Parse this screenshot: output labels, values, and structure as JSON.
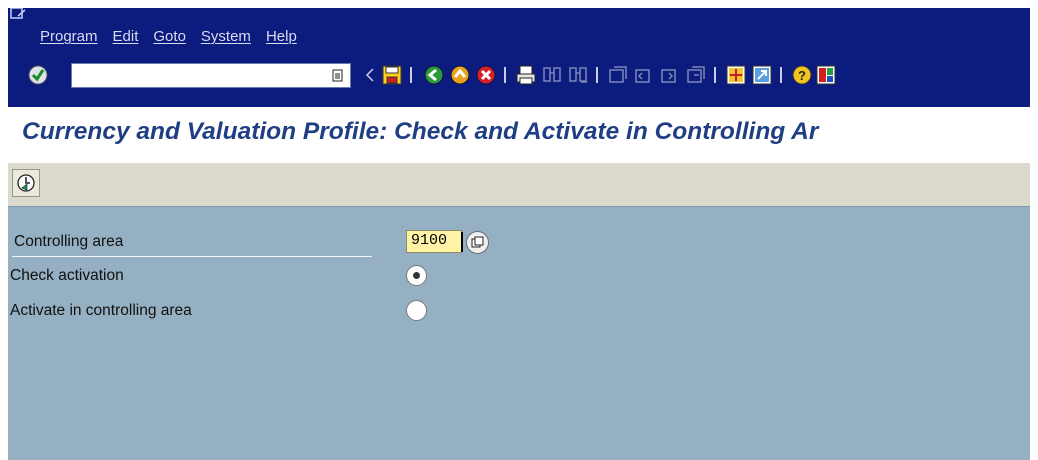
{
  "menu": {
    "items": [
      "Program",
      "Edit",
      "Goto",
      "System",
      "Help"
    ]
  },
  "toolbar": {
    "command_field_value": "",
    "icons": [
      "enter-icon",
      "command-dropdown-icon",
      "prev-arrow-icon",
      "save-icon",
      "back-icon",
      "exit-icon",
      "cancel-icon",
      "print-icon",
      "find-icon",
      "find-next-icon",
      "first-page-icon",
      "previous-page-icon",
      "next-page-icon",
      "last-page-icon",
      "create-session-icon",
      "shortcut-icon",
      "help-icon",
      "customize-layout-icon"
    ]
  },
  "title": "Currency and Valuation Profile: Check and Activate in Controlling Ar",
  "app_toolbar": {
    "icons": [
      "execute-icon"
    ]
  },
  "form": {
    "controlling_area": {
      "label": "Controlling area",
      "value": "9100"
    },
    "options": [
      {
        "label": "Check activation",
        "selected": true
      },
      {
        "label": "Activate in controlling area",
        "selected": false
      }
    ]
  },
  "colors": {
    "header_bg": "#0c1b7e",
    "title_text": "#1f3e84",
    "app_toolbar_bg": "#dcd9cd",
    "content_bg": "#94b0c2",
    "input_bg": "#fff3a6"
  }
}
